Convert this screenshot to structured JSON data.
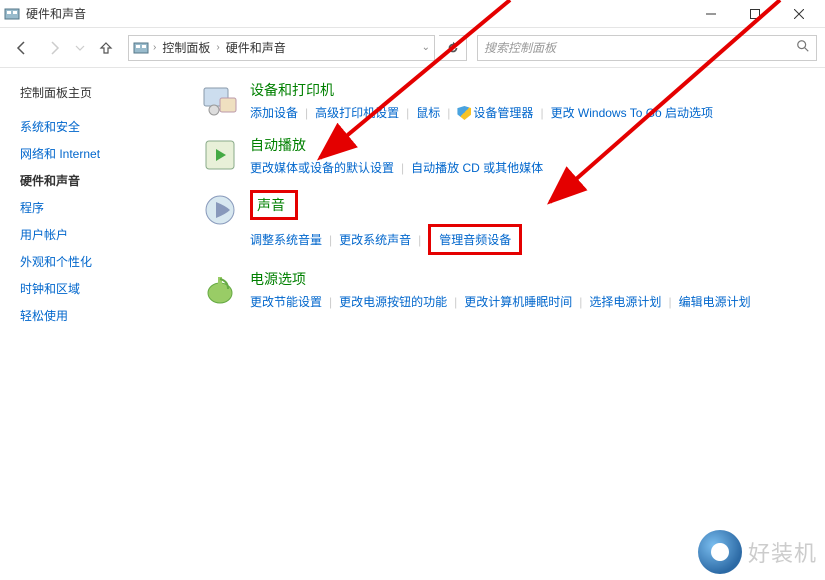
{
  "window": {
    "title": "硬件和声音"
  },
  "breadcrumb": {
    "root": "控制面板",
    "current": "硬件和声音"
  },
  "search": {
    "placeholder": "搜索控制面板"
  },
  "sidebar": {
    "heading": "控制面板主页",
    "items": [
      {
        "label": "系统和安全",
        "current": false
      },
      {
        "label": "网络和 Internet",
        "current": false
      },
      {
        "label": "硬件和声音",
        "current": true
      },
      {
        "label": "程序",
        "current": false
      },
      {
        "label": "用户帐户",
        "current": false
      },
      {
        "label": "外观和个性化",
        "current": false
      },
      {
        "label": "时钟和区域",
        "current": false
      },
      {
        "label": "轻松使用",
        "current": false
      }
    ]
  },
  "categories": [
    {
      "title": "设备和打印机",
      "links": [
        {
          "label": "添加设备"
        },
        {
          "label": "高级打印机设置"
        },
        {
          "label": "鼠标"
        },
        {
          "label": "设备管理器",
          "shield": true
        },
        {
          "label": "更改 Windows To Go 启动选项"
        }
      ]
    },
    {
      "title": "自动播放",
      "links": [
        {
          "label": "更改媒体或设备的默认设置"
        },
        {
          "label": "自动播放 CD 或其他媒体"
        }
      ]
    },
    {
      "title": "声音",
      "links": [
        {
          "label": "调整系统音量"
        },
        {
          "label": "更改系统声音"
        },
        {
          "label": "管理音频设备",
          "highlight": true
        }
      ],
      "highlightTitle": true
    },
    {
      "title": "电源选项",
      "links": [
        {
          "label": "更改节能设置"
        },
        {
          "label": "更改电源按钮的功能"
        },
        {
          "label": "更改计算机睡眠时间"
        },
        {
          "label": "选择电源计划"
        },
        {
          "label": "编辑电源计划"
        }
      ]
    }
  ],
  "watermark": {
    "text": "好装机"
  }
}
